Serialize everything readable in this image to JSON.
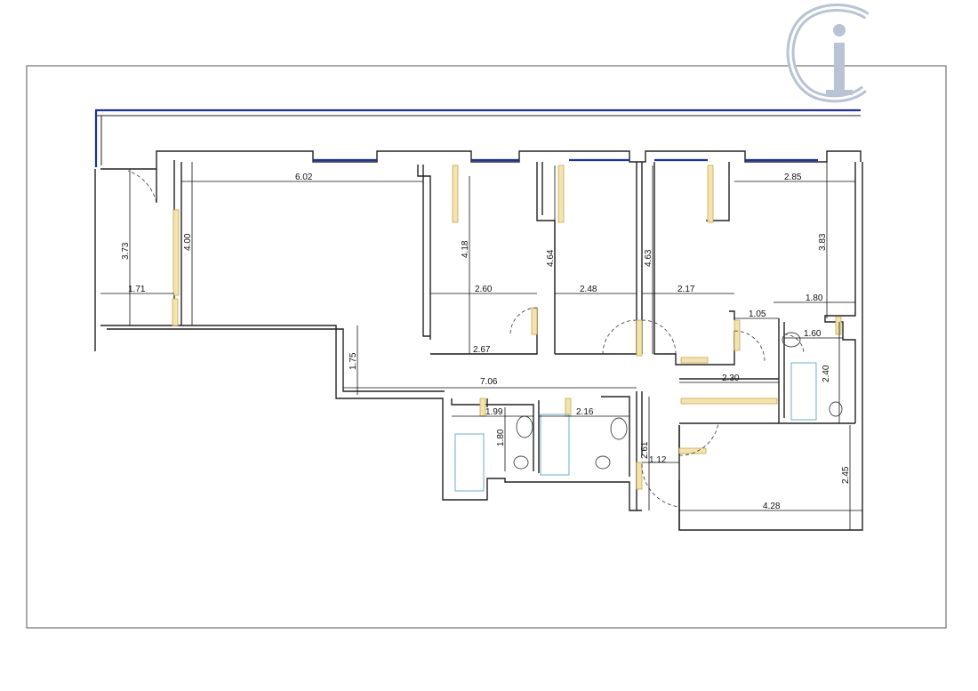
{
  "logo": {
    "text": "Ci",
    "color": "#b8c3d6"
  },
  "colors": {
    "wall": "#222222",
    "window": "#1b2fa8",
    "door_frame": "#c9a84a",
    "fixture": "#5aa6c9"
  },
  "dimensions": {
    "d_6_02": "6.02",
    "d_4_00": "4.00",
    "d_3_73": "3.73",
    "d_1_71": "1.71",
    "d_4_18": "4.18",
    "d_2_60": "2.60",
    "d_4_64": "4.64",
    "d_2_48": "2.48",
    "d_4_63": "4.63",
    "d_2_17": "2.17",
    "d_2_85": "2.85",
    "d_3_83": "3.83",
    "d_1_80_top": "1.80",
    "d_1_05": "1.05",
    "d_1_60": "1.60",
    "d_2_67": "2.67",
    "d_1_75": "1.75",
    "d_7_06": "7.06",
    "d_2_30": "2.30",
    "d_2_40": "2.40",
    "d_1_99": "1.99",
    "d_2_16": "2.16",
    "d_1_80_bath": "1.80",
    "d_2_61": "2.61",
    "d_1_12": "1.12",
    "d_2_45": "2.45",
    "d_4_28": "4.28"
  }
}
